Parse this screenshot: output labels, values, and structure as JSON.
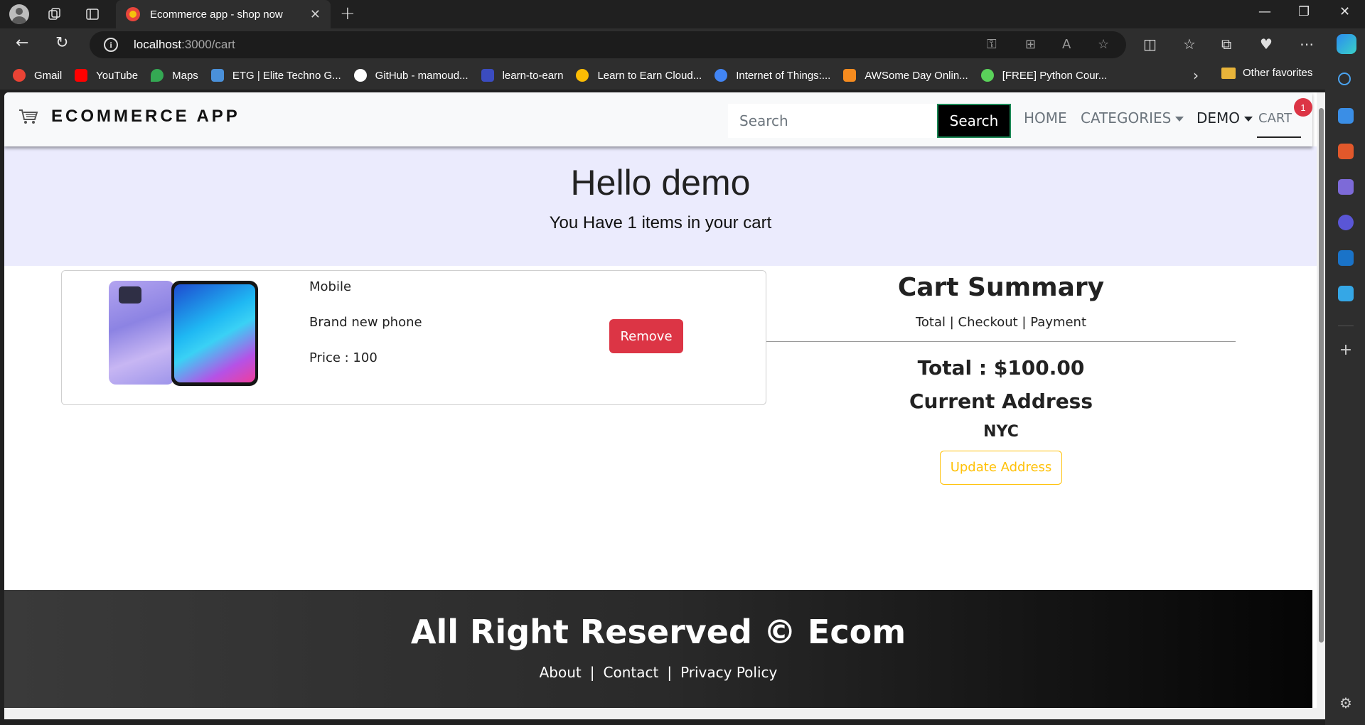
{
  "browser": {
    "tab_title": "Ecommerce app - shop now",
    "url_host": "localhost",
    "url_path": ":3000/cart",
    "bookmarks": [
      {
        "label": "Gmail",
        "color": "#ea4335"
      },
      {
        "label": "YouTube",
        "color": "#ff0000"
      },
      {
        "label": "Maps",
        "color": "#34a853"
      },
      {
        "label": "ETG | Elite Techno G...",
        "color": "#4a90d9"
      },
      {
        "label": "GitHub - mamoud...",
        "color": "#ffffff"
      },
      {
        "label": "learn-to-earn",
        "color": "#3b4cc0"
      },
      {
        "label": "Learn to Earn Cloud...",
        "color": "#fbbc04"
      },
      {
        "label": "Internet of Things:...",
        "color": "#4285f4"
      },
      {
        "label": "AWSome Day Onlin...",
        "color": "#f58b1f"
      },
      {
        "label": "[FREE] Python Cour...",
        "color": "#5ad25a"
      }
    ],
    "other_favorites": "Other favorites"
  },
  "navbar": {
    "brand": "ECOMMERCE APP",
    "search_placeholder": "Search",
    "search_button": "Search",
    "links": {
      "home": "HOME",
      "categories": "CATEGORIES",
      "user": "DEMO",
      "cart": "CART"
    },
    "cart_count": "1"
  },
  "hero": {
    "greeting": "Hello demo",
    "message": "You Have 1 items in your cart"
  },
  "cart_items": [
    {
      "name": "Mobile",
      "description": "Brand new phone",
      "price": "Price : 100",
      "remove_label": "Remove"
    }
  ],
  "summary": {
    "title": "Cart Summary",
    "subtitle": "Total | Checkout | Payment",
    "total": "Total : $100.00",
    "address_heading": "Current Address",
    "address": "NYC",
    "update_button": "Update Address"
  },
  "footer": {
    "text": "All Right Reserved © Ecom",
    "links": [
      "About",
      "Contact",
      "Privacy Policy"
    ]
  },
  "colors": {
    "hero_bg": "#ebebfd",
    "remove": "#dc3545",
    "update": "#ffc107",
    "badge": "#dc3545"
  }
}
